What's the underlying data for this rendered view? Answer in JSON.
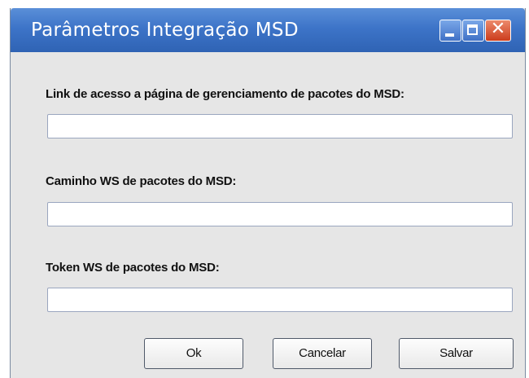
{
  "window": {
    "title": "Parâmetros Integração MSD",
    "controls": {
      "minimize_icon": "minimize-icon",
      "maximize_icon": "maximize-icon",
      "close_icon": "close-icon",
      "close_glyph": "✕"
    }
  },
  "form": {
    "link_label": "Link de acesso a página de gerenciamento de pacotes do MSD:",
    "link_value": "",
    "ws_path_label": "Caminho WS de pacotes do MSD:",
    "ws_path_value": "",
    "token_label": "Token WS de pacotes do MSD:",
    "token_value": ""
  },
  "buttons": {
    "ok": "Ok",
    "cancel": "Cancelar",
    "save": "Salvar"
  },
  "colors": {
    "titlebar": "#3d74c8",
    "close_button": "#cc3c1c",
    "background": "#e6e6e6"
  }
}
